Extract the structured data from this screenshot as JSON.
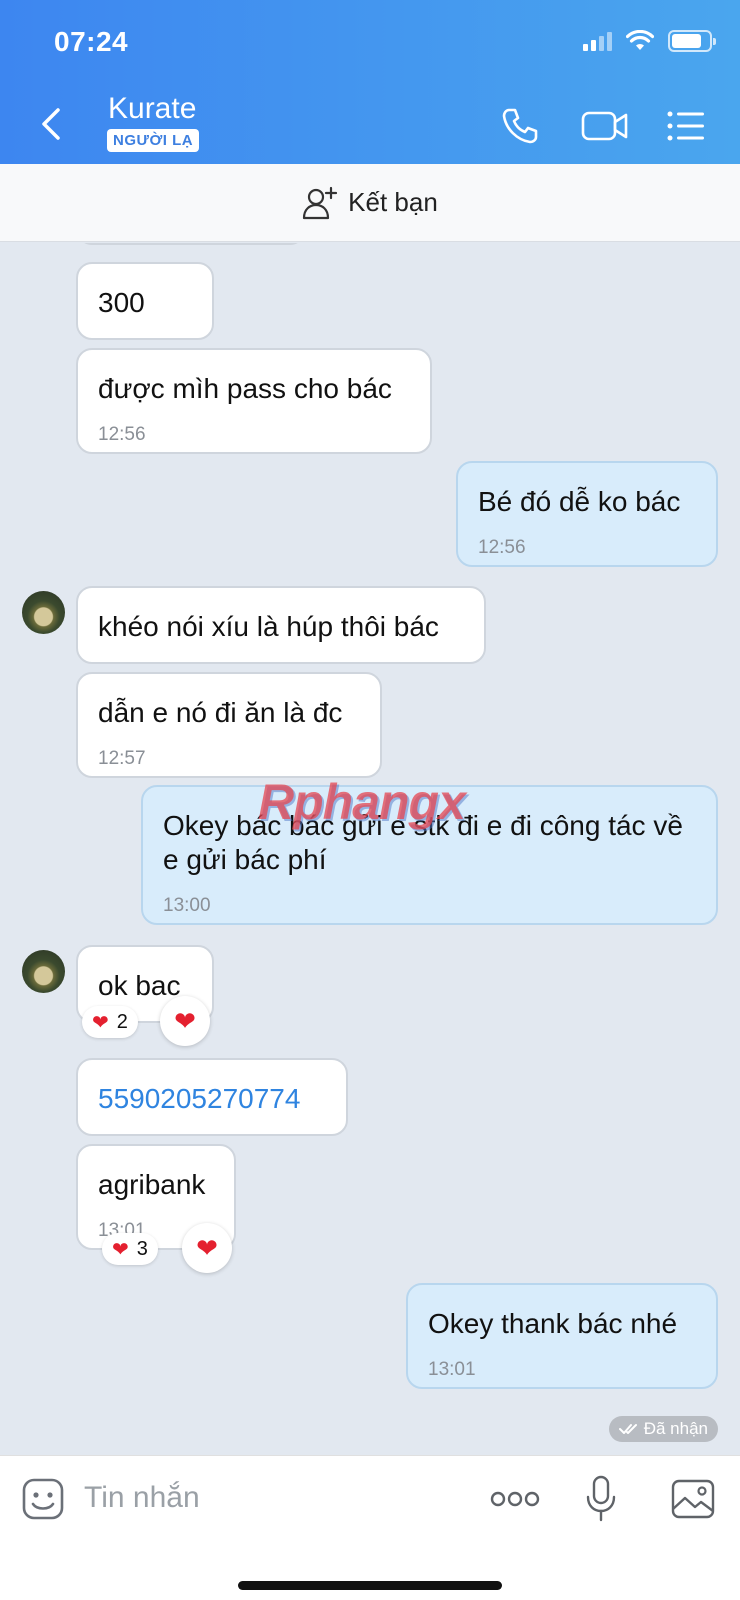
{
  "status_bar": {
    "time": "07:24"
  },
  "header": {
    "contact_name": "Kurate",
    "badge": "NGƯỜI LẠ"
  },
  "friend_bar": {
    "label": "Kết bạn"
  },
  "messages": [
    {
      "dir": "in",
      "text": "300"
    },
    {
      "dir": "in",
      "text": "được mìh pass cho bác",
      "time": "12:56"
    },
    {
      "dir": "out",
      "text": "Bé đó dễ ko bác",
      "time": "12:56"
    },
    {
      "dir": "in",
      "text": "khéo nói xíu là húp thôi bác"
    },
    {
      "dir": "in",
      "text": "dẫn e nó đi ăn là đc",
      "time": "12:57"
    },
    {
      "dir": "out",
      "text": "Okey bác bác gửi e stk đi e đi công tác về e gửi bác phí",
      "time": "13:00"
    },
    {
      "dir": "in",
      "text": "ok bac",
      "reaction_count": "2"
    },
    {
      "dir": "in",
      "text": "5590205270774"
    },
    {
      "dir": "in",
      "text": "agribank",
      "time": "13:01",
      "reaction_count": "3"
    },
    {
      "dir": "out",
      "text": "Okey thank bác nhé",
      "time": "13:01"
    }
  ],
  "watermark": "Rphangx",
  "receipt": "Đã nhận",
  "input": {
    "placeholder": "Tin nhắn"
  }
}
